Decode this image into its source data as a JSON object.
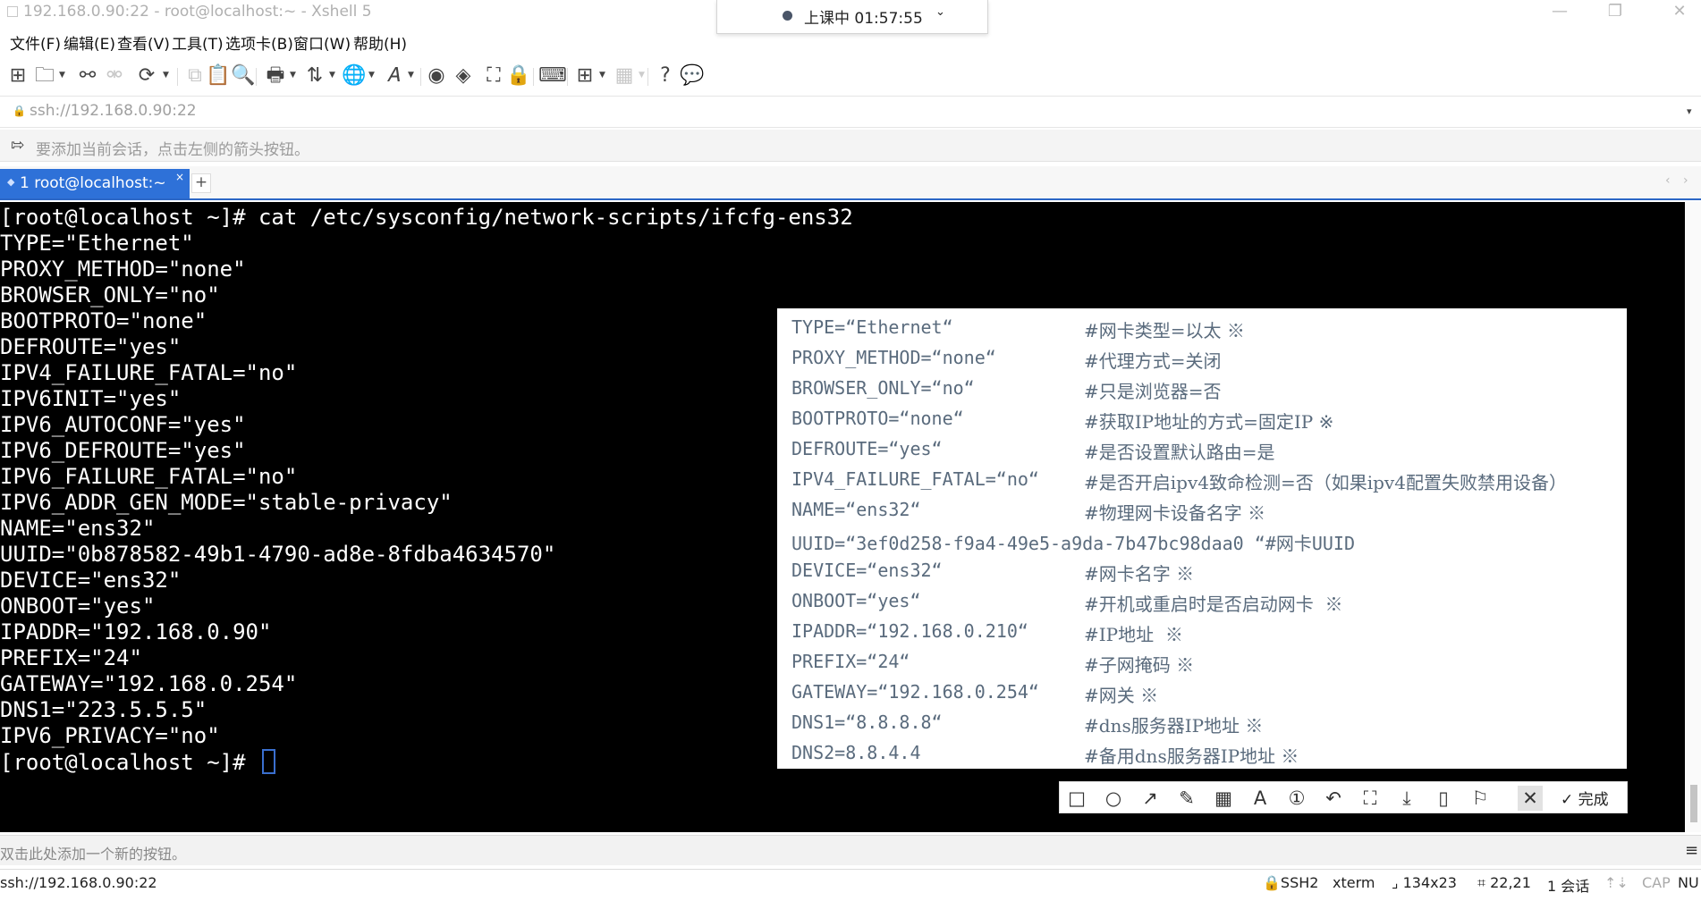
{
  "window": {
    "title": "192.168.0.90:22 - root@localhost:~ - Xshell 5",
    "minimize_glyph": "—",
    "maximize_glyph": "❐",
    "close_glyph": "✕"
  },
  "class_timer": {
    "label": "上课中 01:57:55",
    "chevron": "⌄"
  },
  "menu": [
    "文件(F)",
    "编辑(E)",
    "查看(V)",
    "工具(T)",
    "选项卡(B)",
    "窗口(W)",
    "帮助(H)"
  ],
  "address": {
    "value": "ssh://192.168.0.90:22",
    "dropdown_glyph": "▾"
  },
  "session_hint": "要添加当前会话，点击左侧的箭头按钮。",
  "tabs": [
    {
      "label": "1 root@localhost:~",
      "close": "×"
    }
  ],
  "tab_add_label": "+",
  "tab_nav": {
    "prev": "‹",
    "next": "›"
  },
  "terminal": {
    "lines": [
      "[root@localhost ~]# cat /etc/sysconfig/network-scripts/ifcfg-ens32",
      "TYPE=\"Ethernet\"",
      "PROXY_METHOD=\"none\"",
      "BROWSER_ONLY=\"no\"",
      "BOOTPROTO=\"none\"",
      "DEFROUTE=\"yes\"",
      "IPV4_FAILURE_FATAL=\"no\"",
      "IPV6INIT=\"yes\"",
      "IPV6_AUTOCONF=\"yes\"",
      "IPV6_DEFROUTE=\"yes\"",
      "IPV6_FAILURE_FATAL=\"no\"",
      "IPV6_ADDR_GEN_MODE=\"stable-privacy\"",
      "NAME=\"ens32\"",
      "UUID=\"0b878582-49b1-4790-ad8e-8fdba4634570\"",
      "DEVICE=\"ens32\"",
      "ONBOOT=\"yes\"",
      "IPADDR=\"192.168.0.90\"",
      "PREFIX=\"24\"",
      "GATEWAY=\"192.168.0.254\"",
      "DNS1=\"223.5.5.5\"",
      "IPV6_PRIVACY=\"no\""
    ],
    "prompt": "[root@localhost ~]# "
  },
  "notes": [
    {
      "key": "TYPE=“Ethernet“",
      "comment": "#网卡类型=以太 ※"
    },
    {
      "key": "PROXY_METHOD=“none“",
      "comment": "#代理方式=关闭"
    },
    {
      "key": "BROWSER_ONLY=“no“",
      "comment": "#只是浏览器=否"
    },
    {
      "key": "BOOTPROTO=“none“",
      "comment": "#获取IP地址的方式=固定IP ※"
    },
    {
      "key": "DEFROUTE=“yes“",
      "comment": "#是否设置默认路由=是"
    },
    {
      "key": "IPV4_FAILURE_FATAL=“no“",
      "comment": "#是否开启ipv4致命检测=否（如果ipv4配置失败禁用设备）"
    },
    {
      "key": "NAME=“ens32“",
      "comment": "#物理网卡设备名字 ※"
    },
    {
      "key": "UUID=“3ef0d258-f9a4-49e5-a9da-7b47bc98daa0 “#网卡UUID",
      "comment": ""
    },
    {
      "key": "DEVICE=“ens32“",
      "comment": "#网卡名字 ※"
    },
    {
      "key": "ONBOOT=“yes“",
      "comment": "#开机或重启时是否启动网卡  ※"
    },
    {
      "key": "IPADDR=“192.168.0.210“",
      "comment": "#IP地址  ※"
    },
    {
      "key": "PREFIX=“24“",
      "comment": "#子网掩码 ※"
    },
    {
      "key": "GATEWAY=“192.168.0.254“",
      "comment": "#网关 ※"
    },
    {
      "key": "DNS1=“8.8.8.8“",
      "comment": "#dns服务器IP地址 ※"
    },
    {
      "key": "DNS2=8.8.4.4",
      "comment": "#备用dns服务器IP地址 ※"
    }
  ],
  "annotation_toolbar": {
    "tools": [
      {
        "name": "rectangle-tool-icon",
        "glyph": "□"
      },
      {
        "name": "ellipse-tool-icon",
        "glyph": "○"
      },
      {
        "name": "arrow-tool-icon",
        "glyph": "↗"
      },
      {
        "name": "pen-tool-icon",
        "glyph": "✎"
      },
      {
        "name": "mosaic-tool-icon",
        "glyph": "▦"
      },
      {
        "name": "text-tool-icon",
        "glyph": "A"
      },
      {
        "name": "number-tool-icon",
        "glyph": "①"
      },
      {
        "name": "undo-icon",
        "glyph": "↶"
      },
      {
        "name": "crop-icon",
        "glyph": "⛶"
      },
      {
        "name": "download-icon",
        "glyph": "⤓"
      },
      {
        "name": "pin-icon",
        "glyph": "▯"
      },
      {
        "name": "bookmark-icon",
        "glyph": "⚐"
      },
      {
        "name": "cancel-icon",
        "glyph": "✕"
      }
    ],
    "done_label": "✓ 完成"
  },
  "quick_command_hint": "双击此处添加一个新的按钮。",
  "quick_menu_glyph": "≡",
  "status": {
    "connection": "ssh://192.168.0.90:22",
    "protocol": "SSH2",
    "terminal_type": "xterm",
    "size": "134x23",
    "cursor_pos": "22,21",
    "sessions": "1 会话",
    "cap": "CAP",
    "num": "NU"
  },
  "colors": {
    "tab_active": "#2e71d8",
    "terminal_bg": "#000000",
    "terminal_fg": "#ffffff",
    "note_text": "#5a6b7d"
  }
}
